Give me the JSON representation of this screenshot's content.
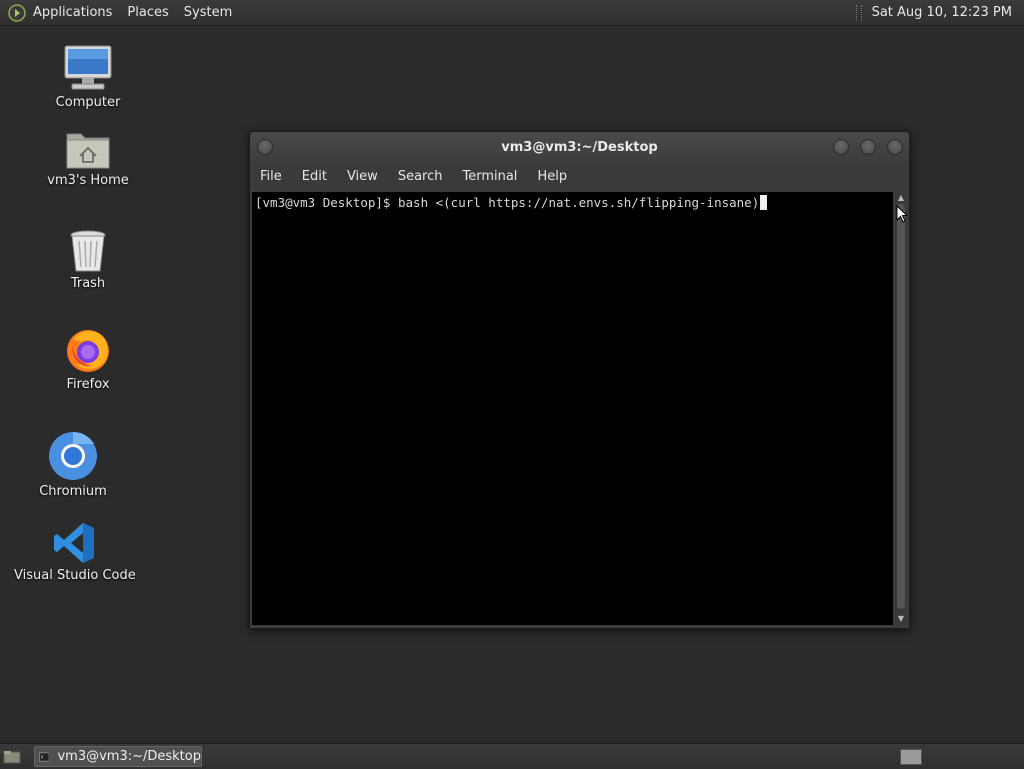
{
  "top_panel": {
    "menus": [
      "Applications",
      "Places",
      "System"
    ],
    "clock": "Sat Aug 10, 12:23 PM"
  },
  "desktop_icons": [
    {
      "label": "Computer",
      "icon": "computer-icon"
    },
    {
      "label": "vm3's Home",
      "icon": "home-folder-icon"
    },
    {
      "label": "Trash",
      "icon": "trash-icon"
    },
    {
      "label": "Firefox",
      "icon": "firefox-icon"
    },
    {
      "label": "Chromium",
      "icon": "chromium-icon"
    },
    {
      "label": "Visual Studio Code",
      "icon": "vscode-icon"
    }
  ],
  "terminal": {
    "title": "vm3@vm3:~/Desktop",
    "menus": [
      "File",
      "Edit",
      "View",
      "Search",
      "Terminal",
      "Help"
    ],
    "line": "[vm3@vm3 Desktop]$ bash <(curl https://nat.envs.sh/flipping-insane)"
  },
  "bottom_panel": {
    "task_label": "vm3@vm3:~/Desktop"
  },
  "colors": {
    "desktop_bg": "#2b2b2b",
    "terminal_bg": "#000000",
    "terminal_text": "#d8d8d8",
    "vscode_blue": "#2f8fe0",
    "chromium_blue": "#4a8fe0"
  }
}
